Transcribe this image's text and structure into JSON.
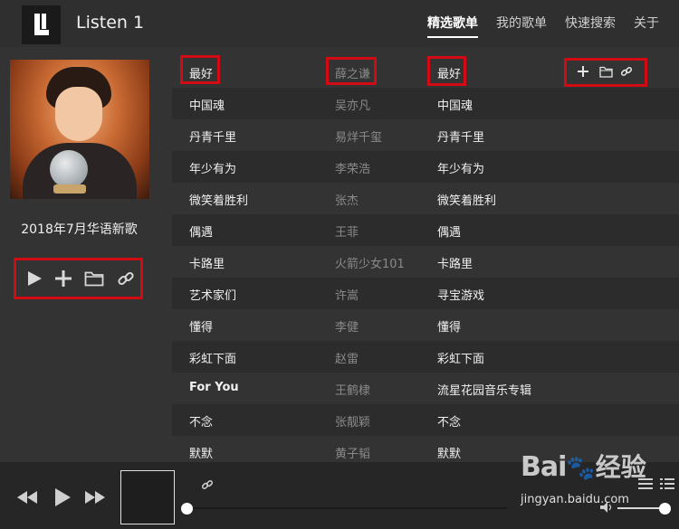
{
  "app": {
    "title": "Listen 1"
  },
  "nav": [
    {
      "label": "精选歌单",
      "active": true
    },
    {
      "label": "我的歌单",
      "active": false
    },
    {
      "label": "快速搜索",
      "active": false
    },
    {
      "label": "关于",
      "active": false
    }
  ],
  "playlist": {
    "title": "2018年7月华语新歌"
  },
  "playlist_actions": [
    "play-icon",
    "add-icon",
    "folder-icon",
    "link-icon"
  ],
  "table": {
    "header": {
      "title": "最好",
      "artist": "薛之谦",
      "album": "最好"
    },
    "header_actions": [
      "add-icon",
      "folder-icon",
      "link-icon"
    ],
    "rows": [
      {
        "title": "中国魂",
        "artist": "吴亦凡",
        "album": "中国魂"
      },
      {
        "title": "丹青千里",
        "artist": "易烊千玺",
        "album": "丹青千里"
      },
      {
        "title": "年少有为",
        "artist": "李荣浩",
        "album": "年少有为"
      },
      {
        "title": "微笑着胜利",
        "artist": "张杰",
        "album": "微笑着胜利"
      },
      {
        "title": "偶遇",
        "artist": "王菲",
        "album": "偶遇"
      },
      {
        "title": "卡路里",
        "artist": "火箭少女101",
        "album": "卡路里"
      },
      {
        "title": "艺术家们",
        "artist": "许嵩",
        "album": "寻宝游戏"
      },
      {
        "title": "懂得",
        "artist": "李健",
        "album": "懂得"
      },
      {
        "title": "彩虹下面",
        "artist": "赵雷",
        "album": "彩虹下面"
      },
      {
        "title": "For You",
        "artist": "王鹤棣",
        "album": "流星花园音乐专辑"
      },
      {
        "title": "不念",
        "artist": "张靓颖",
        "album": "不念"
      },
      {
        "title": "默默",
        "artist": "黄子韬",
        "album": "默默"
      }
    ]
  },
  "player": {
    "progress": 0,
    "volume": 1.0
  },
  "watermark": {
    "logo": "Bai",
    "text": "经验",
    "url": "jingyan.baidu.com"
  },
  "colors": {
    "background": "#333333",
    "header": "#2f2f2f",
    "highlight_box": "#d10a14",
    "footer": "#262626"
  }
}
